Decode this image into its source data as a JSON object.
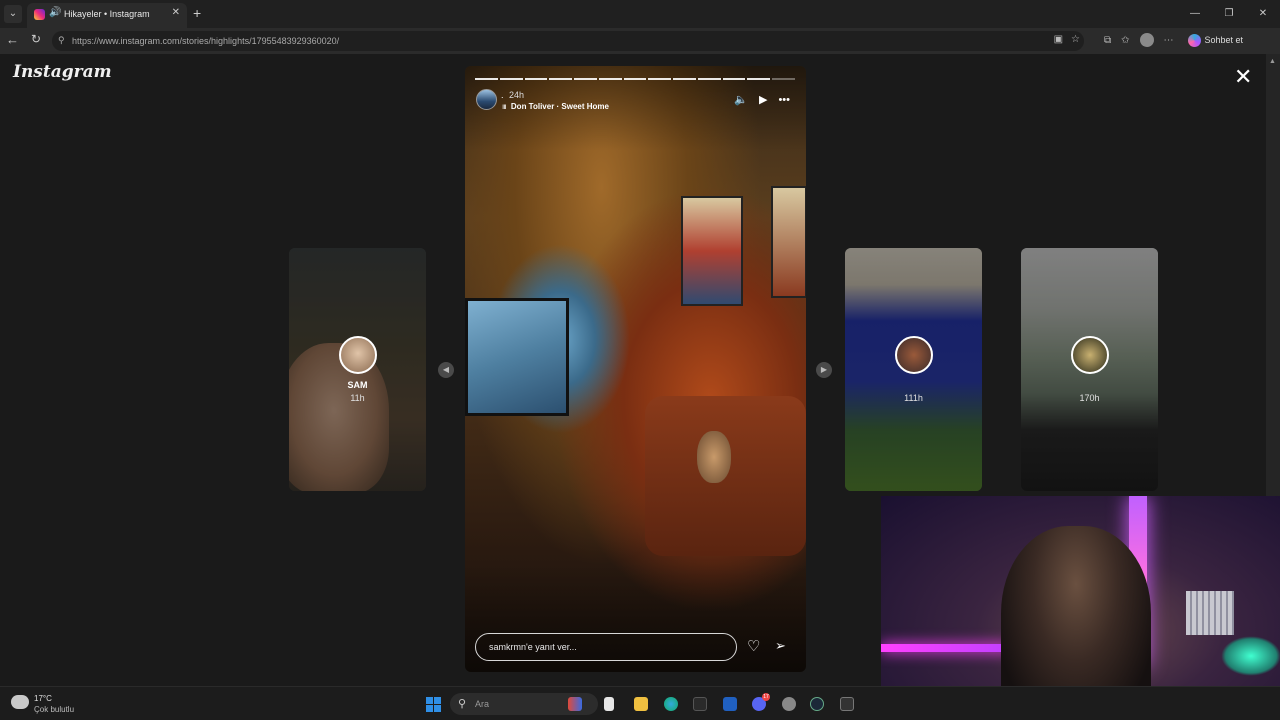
{
  "browser": {
    "tab": {
      "title": "Hikayeler • Instagram",
      "close": "✕"
    },
    "new_tab": "+",
    "window_controls": {
      "minimize": "—",
      "maximize": "❐",
      "close": "✕"
    },
    "nav": {
      "back": "←",
      "reload": "↻"
    },
    "url": "https://www.instagram.com/stories/highlights/17955483929360020/",
    "copilot_label": "Sohbet et"
  },
  "instagram": {
    "logo": "Instagram",
    "close": "✕",
    "main_story": {
      "username": ".",
      "time": "24h",
      "music_bars": "ııı",
      "music": "Don Toliver · Sweet Home",
      "segments_total": 13,
      "segments_watched": 12,
      "controls": {
        "mute": "🔈",
        "play": "▶",
        "more": "•••"
      },
      "reply_placeholder": "samkrmn'e yanıt ver...",
      "like": "♡",
      "share": "➢"
    },
    "side_stories": [
      {
        "name": "SAM",
        "time": "11h"
      },
      {
        "name": "",
        "time": "111h"
      },
      {
        "name": "",
        "time": "170h"
      }
    ],
    "arrows": {
      "prev": "◀",
      "next": "▶"
    }
  },
  "taskbar": {
    "weather_temp": "17°C",
    "weather_desc": "Çok bulutlu",
    "search_label": "Ara",
    "discord_badge": "17"
  },
  "colors": {
    "brand_gradient": [
      "#f9ce34",
      "#ee2a7b",
      "#6228d7"
    ],
    "windows_accent": "#2f8fe6"
  }
}
